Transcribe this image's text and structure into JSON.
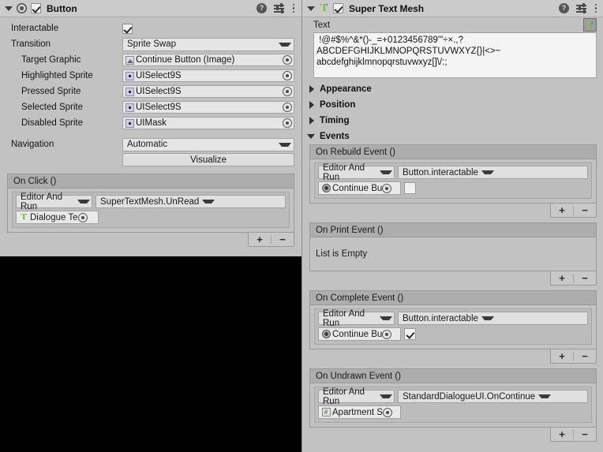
{
  "theme": {
    "panel_bg": "#c2c2c2",
    "header_bg": "#cbcbcb",
    "field_bg": "#e5e5e5",
    "event_header_bg": "#adadad",
    "background": "#000000"
  },
  "button_component": {
    "title": "Button",
    "icons": {
      "foldout": "chevron-down-icon",
      "component": "button-component-icon",
      "enabled": "enabled-checkbox",
      "help": "help-icon",
      "preset": "preset-icon",
      "menu": "kebab-menu-icon"
    },
    "enabled": true,
    "fields": [
      {
        "label": "Interactable",
        "type": "checkbox",
        "value": true
      },
      {
        "label": "Transition",
        "type": "dropdown",
        "value": "Sprite Swap"
      },
      {
        "label": "Target Graphic",
        "type": "object",
        "value": "Continue Button (Image)",
        "icon": "image-icon",
        "indent": true
      },
      {
        "label": "Highlighted Sprite",
        "type": "object",
        "value": "UISelect9S",
        "icon": "sprite-icon",
        "indent": true
      },
      {
        "label": "Pressed Sprite",
        "type": "object",
        "value": "UISelect9S",
        "icon": "sprite-icon",
        "indent": true
      },
      {
        "label": "Selected Sprite",
        "type": "object",
        "value": "UISelect9S",
        "icon": "sprite-icon",
        "indent": true
      },
      {
        "label": "Disabled Sprite",
        "type": "object",
        "value": "UIMask",
        "icon": "sprite-icon",
        "indent": true
      },
      {
        "label": "Navigation",
        "type": "dropdown",
        "value": "Automatic"
      }
    ],
    "visualize_button": "Visualize",
    "on_click": {
      "header": "On Click ()",
      "entries": [
        {
          "callback_state": "Editor And Run",
          "function": "SuperTextMesh.UnRead",
          "object": "Dialogue Te",
          "object_icon": "text-mesh-icon",
          "arg_type": "none"
        }
      ],
      "add_label": "+",
      "remove_label": "−"
    }
  },
  "super_text_mesh_component": {
    "title": "Super Text Mesh",
    "enabled": true,
    "icons": {
      "foldout": "chevron-down-icon",
      "component": "super-text-mesh-icon",
      "enabled": "enabled-checkbox",
      "help": "help-icon",
      "preset": "preset-icon",
      "menu": "kebab-menu-icon"
    },
    "text_field": {
      "label": "Text",
      "swatch_icon": "super-text-mesh-swatch-icon",
      "value": " !@#$%^&*()-_=+0123456789'\"÷×.,?\nABCDEFGHIJKLMNOPQRSTUVWXYZ{}|<>~\nabcdefghijklmnopqrstuvwxyz[]\\/:;"
    },
    "sections": [
      {
        "label": "Appearance",
        "expanded": false
      },
      {
        "label": "Position",
        "expanded": false
      },
      {
        "label": "Timing",
        "expanded": false
      },
      {
        "label": "Events",
        "expanded": true
      }
    ],
    "events": [
      {
        "header": "On Rebuild Event ()",
        "empty": false,
        "empty_label": "",
        "entries": [
          {
            "callback_state": "Editor And Run",
            "function": "Button.interactable",
            "object": "Continue Bu",
            "object_icon": "button-component-icon",
            "arg_type": "bool",
            "arg_value": false
          }
        ]
      },
      {
        "header": "On Print Event ()",
        "empty": true,
        "empty_label": "List is Empty",
        "entries": []
      },
      {
        "header": "On Complete Event ()",
        "empty": false,
        "empty_label": "",
        "entries": [
          {
            "callback_state": "Editor And Run",
            "function": "Button.interactable",
            "object": "Continue Bu",
            "object_icon": "button-component-icon",
            "arg_type": "bool",
            "arg_value": true
          }
        ]
      },
      {
        "header": "On Undrawn Event ()",
        "empty": false,
        "empty_label": "",
        "entries": [
          {
            "callback_state": "Editor And Run",
            "function": "StandardDialogueUI.OnContinue",
            "object": "Apartment S",
            "object_icon": "gameobject-icon",
            "arg_type": "none"
          }
        ]
      }
    ],
    "add_label": "+",
    "remove_label": "−"
  }
}
